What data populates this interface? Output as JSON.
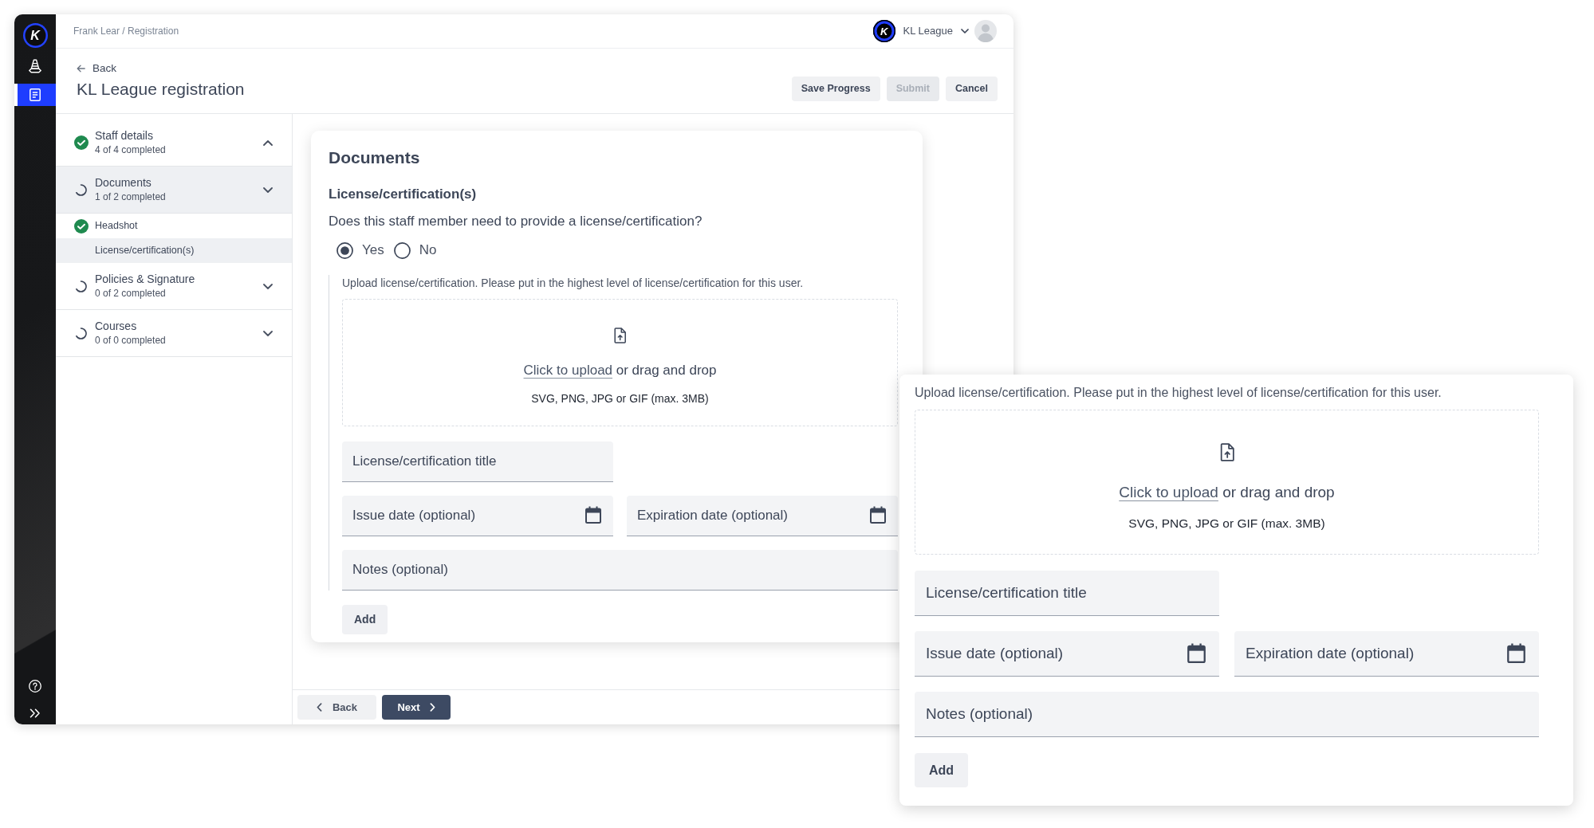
{
  "rail": {
    "logo_text": "K",
    "items": [
      {
        "selected": false
      },
      {
        "selected": true
      }
    ]
  },
  "header": {
    "breadcrumb": "Frank Lear / Registration",
    "org_logo_text": "K",
    "org_name": "KL League"
  },
  "page": {
    "back_link": "Back",
    "title": "KL League registration",
    "actions": [
      {
        "label": "Save Progress",
        "disabled": false
      },
      {
        "label": "Submit",
        "disabled": true
      },
      {
        "label": "Cancel",
        "disabled": false
      }
    ]
  },
  "steps": [
    {
      "title": "Staff details",
      "subtitle": "4 of 4 completed",
      "completed": true,
      "expanded": true,
      "selected": false
    },
    {
      "title": "Documents",
      "subtitle": "1 of 2 completed",
      "completed": false,
      "expanded": false,
      "selected": true,
      "children": [
        {
          "title": "Headshot",
          "completed": true,
          "selected": false
        },
        {
          "title": "License/certification(s)",
          "selected": true
        }
      ]
    },
    {
      "title": "Policies & Signature",
      "subtitle": "0 of 2 completed",
      "completed": false,
      "expanded": false,
      "selected": false
    },
    {
      "title": "Courses",
      "subtitle": "0 of 0 completed",
      "completed": false,
      "expanded": false,
      "selected": false
    }
  ],
  "form": {
    "heading": "Documents",
    "section_title": "License/certification(s)",
    "question": "Does this staff member need to provide a license/certification?",
    "options": [
      {
        "label": "Yes",
        "selected": true
      },
      {
        "label": "No",
        "selected": false
      }
    ],
    "upload": {
      "instructions": "Upload license/certification. Please put in the highest level of license/certification for this user.",
      "link": "Click to upload",
      "link_suffix": "or drag and drop",
      "formats": "SVG, PNG, JPG or GIF (max. 3MB)"
    },
    "field_rows": [
      [
        {
          "kind": "text",
          "placeholder": "License/certification title"
        }
      ],
      [
        {
          "kind": "date",
          "placeholder": "Issue date (optional)"
        },
        {
          "kind": "date",
          "placeholder": "Expiration date (optional)"
        }
      ],
      [
        {
          "kind": "notes",
          "placeholder": "Notes (optional)"
        }
      ]
    ],
    "add_button": "Add"
  },
  "footer_nav": {
    "back": "Back",
    "next": "Next"
  },
  "callout": {
    "upload": {
      "instructions": "Upload license/certification. Please put in the highest level of license/certification for this user.",
      "link": "Click to upload",
      "link_suffix": "or drag and drop",
      "formats": "SVG, PNG, JPG or GIF (max. 3MB)"
    },
    "field_rows": [
      [
        {
          "kind": "text",
          "placeholder": "License/certification title"
        }
      ],
      [
        {
          "kind": "date",
          "placeholder": "Issue date (optional)"
        },
        {
          "kind": "date",
          "placeholder": "Expiration date (optional)"
        }
      ],
      [
        {
          "kind": "notes",
          "placeholder": "Notes (optional)"
        }
      ]
    ],
    "add_button": "Add"
  }
}
